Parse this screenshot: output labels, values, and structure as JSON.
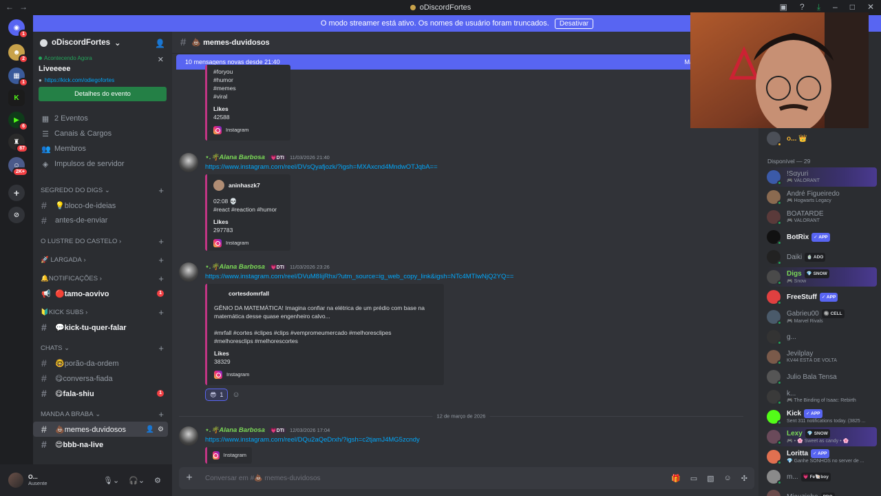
{
  "titlebar": {
    "nav_back": "←",
    "nav_fwd": "→",
    "title": "oDiscordFortes"
  },
  "streamer_mode": {
    "text": "O modo streamer está ativo. Os nomes de usuário foram truncados.",
    "button": "Desativar"
  },
  "rail": {
    "badges": [
      "1",
      "2",
      "1",
      "6",
      "87",
      "2K+"
    ]
  },
  "server": {
    "name": "oDiscordFortes",
    "event": {
      "status": "Acontecendo Agora",
      "title": "Liveeeee",
      "link": "https://kick.com/odiegofortes",
      "button": "Detalhes do evento"
    },
    "items": [
      "2 Eventos",
      "Canais & Cargos",
      "Membros",
      "Impulsos de servidor"
    ],
    "categories": {
      "segredo": "SEGREDO DO DIGS",
      "lustre": "O LUSTRE DO CASTELO",
      "largada": "🚀 LARGADA",
      "notificacoes": "🔔NOTIFICAÇÕES",
      "kick_subs": "🔰KICK SUBS",
      "chats": "CHATS",
      "manda": "MANDA A BRABA"
    },
    "channels": {
      "bloco": "💡bloco-de-ideias",
      "antes": "antes-de-enviar",
      "tamo": "🔴tamo-aovivo",
      "tamo_badge": "1",
      "kick_tu": "💬kick-tu-quer-falar",
      "porao": "🤓porão-da-ordem",
      "conversa": "😋conversa-fiada",
      "fala": "😋fala-shiu",
      "fala_badge": "1",
      "memes": "💩memes-duvidosos",
      "bbb": "😍bbb-na-live"
    }
  },
  "user": {
    "name": "O...",
    "status": "Ausente"
  },
  "chat": {
    "channel": "💩 memes-duvidosos",
    "new_messages": "10 mensagens novas desde 21:40",
    "new_messages_right": "Mar",
    "embed0": {
      "lines": [
        "#foryou",
        "#humor",
        "#memes",
        "#viral"
      ],
      "likes_label": "Likes",
      "likes": "42588",
      "footer": "Instagram"
    },
    "msg1": {
      "user": "⋆.🌴Alana Barbosa",
      "tag": "💗DTI",
      "time": "11/03/2026 21:40",
      "url": "https://www.instagram.com/reel/DVsQyafjozk/?igsh=MXAxcnd4MndwOTJqbA==",
      "embed": {
        "author": "aninhaszk7",
        "desc1": "02:08 💀",
        "desc2": "#react #reaction #humor",
        "likes_label": "Likes",
        "likes": "297783",
        "footer": "Instagram"
      }
    },
    "msg2": {
      "user": "⋆.🌴Alana Barbosa",
      "tag": "💗DTI",
      "time": "11/03/2026 23:26",
      "url": "https://www.instagram.com/reel/DVuM8IijRhx/?utm_source=ig_web_copy_link&igsh=NTc4MTIwNjQ2YQ==",
      "embed": {
        "author": "cortesdomrfall",
        "desc1": "GÊNIO DA MATEMÁTICA! Imagina confiar na elétrica de um prédio com base na",
        "desc2": "matemática desse quase engenheiro calvo...",
        "desc3": "#mrfall #cortes #clipes #clips #vempromeumercado #melhoresclipes",
        "desc4": "#melhoresclips #melhorescortes",
        "likes_label": "Likes",
        "likes": "38329",
        "footer": "Instagram"
      },
      "reaction_count": "1"
    },
    "date_divider": "12 de março de 2026",
    "msg3": {
      "user": "⋆.🌴Alana Barbosa",
      "tag": "💗DTI",
      "time": "12/03/2026 17:04",
      "url": "https://www.instagram.com/reel/DQu2aQeDrxh/?igsh=c2tjamJ4MG5zcndy",
      "embed": {
        "footer": "Instagram"
      }
    },
    "composer_placeholder": "Conversar em #💩 memes-duvidosos"
  },
  "members": {
    "top_member": "o... 👑",
    "available_header": "Disponível — 29",
    "list": [
      {
        "name": "!Sαyuri",
        "status": "🎮 VALORANT",
        "color": "#949ba4"
      },
      {
        "name": "André Figueiredo",
        "status": "🎮 Hogwarts Legacy",
        "color": "#949ba4"
      },
      {
        "name": "BOATARDE",
        "status": "🎮 VALORANT",
        "color": "#949ba4"
      },
      {
        "name": "BotRix",
        "tag": "✓ APP",
        "status": "",
        "color": "#f2f3f5"
      },
      {
        "name": "Daiki",
        "tag": "🍵 ADO",
        "status": "",
        "color": "#949ba4"
      },
      {
        "name": "Digs",
        "tag": "💎 SNOW",
        "status": "🎮 Snow",
        "color": "#7bd957"
      },
      {
        "name": "FreeStuff",
        "tag": "✓ APP",
        "status": "",
        "color": "#f2f3f5"
      },
      {
        "name": "Gabrieu00",
        "tag": "🔘 CELL",
        "status": "🎮 Marvel Rivals",
        "color": "#949ba4"
      },
      {
        "name": "g...",
        "status": "",
        "color": "#949ba4"
      },
      {
        "name": "Jevilplay",
        "status": "KV44 ESTÁ DE VOLTA",
        "color": "#949ba4"
      },
      {
        "name": "Julio Bala Tensa",
        "status": "",
        "color": "#949ba4"
      },
      {
        "name": "k...",
        "status": "🎮 The Binding of Isaac: Rebirth",
        "color": "#949ba4"
      },
      {
        "name": "Kick",
        "tag": "✓ APP",
        "status": "Sent 311 notifications today. (3825 ...",
        "color": "#f2f3f5"
      },
      {
        "name": "Lexy",
        "tag": "💎 SNOW",
        "status": "🎮 • 🌸 Sweet as candy • 🌸",
        "color": "#7bd957"
      },
      {
        "name": "Loritta",
        "tag": "✓ APP",
        "status": "💎 Ganhe SONHOS no server de ...",
        "color": "#f2f3f5"
      },
      {
        "name": "m...",
        "tag": "💗 Fe🐚boy",
        "status": "",
        "color": "#949ba4"
      },
      {
        "name": "Miauzinho",
        "tag": "PRO",
        "status": "",
        "color": "#949ba4"
      }
    ]
  },
  "colors": {
    "blurple": "#5865f2",
    "green": "#23a55a",
    "red": "#f23f43",
    "link": "#00a8fc",
    "instagram": "#c13584"
  }
}
